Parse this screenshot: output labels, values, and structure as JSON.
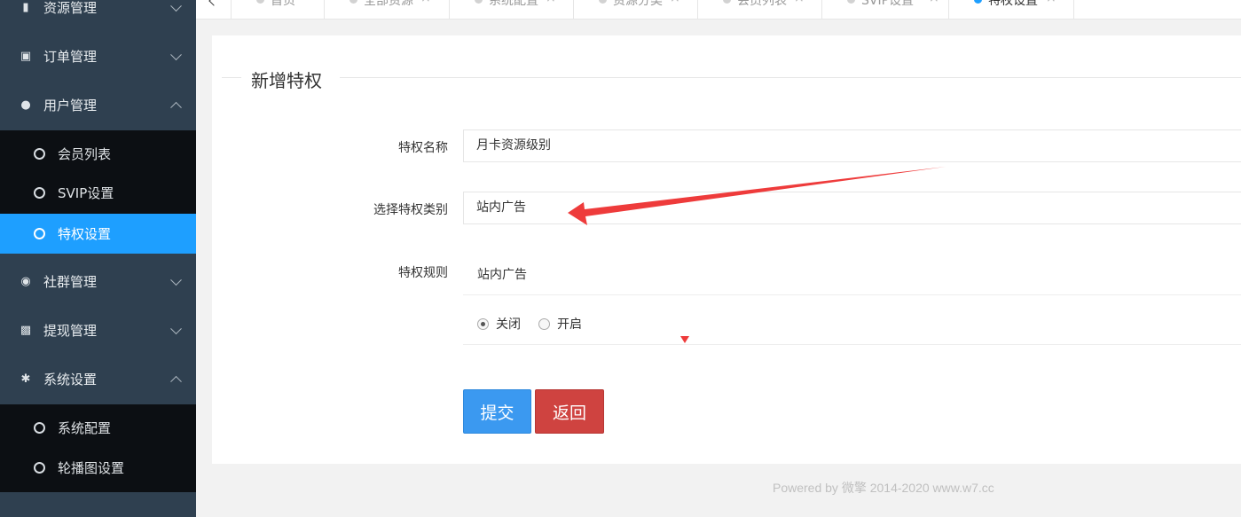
{
  "sidebar": {
    "menus": [
      {
        "label": "资源管理",
        "icon": "book-icon",
        "expanded": false
      },
      {
        "label": "订单管理",
        "icon": "cart-icon",
        "expanded": false
      },
      {
        "label": "用户管理",
        "icon": "users-icon",
        "expanded": true
      },
      {
        "label": "社群管理",
        "icon": "comments-icon",
        "expanded": false
      },
      {
        "label": "提现管理",
        "icon": "money-icon",
        "expanded": false
      },
      {
        "label": "系统设置",
        "icon": "gear-icon",
        "expanded": true
      }
    ],
    "user_sub": [
      {
        "label": "会员列表"
      },
      {
        "label": "SVIP设置"
      },
      {
        "label": "特权设置",
        "active": true
      }
    ],
    "system_sub": [
      {
        "label": "系统配置"
      },
      {
        "label": "轮播图设置"
      }
    ]
  },
  "tabs": [
    {
      "label": "首页"
    },
    {
      "label": "全部资源"
    },
    {
      "label": "系统配置"
    },
    {
      "label": "资源分类"
    },
    {
      "label": "会员列表"
    },
    {
      "label": "SVIP设置"
    },
    {
      "label": "特权设置",
      "active": true
    }
  ],
  "tab_close": "×",
  "form": {
    "legend": "新增特权",
    "name_label": "特权名称",
    "name_value": "月卡资源级别",
    "type_label": "选择特权类别",
    "type_value": "站内广告",
    "rule_label": "特权规则",
    "rule_title": "站内广告",
    "radio_off": "关闭",
    "radio_on": "开启",
    "selected": "关闭",
    "submit": "提交",
    "back": "返回"
  },
  "footer": "Powered by 微擎 2014-2020 www.w7.cc",
  "colors": {
    "sidebar_bg": "#2f4050",
    "sub_bg": "#0c0f13",
    "active_blue": "#1e9fff",
    "submit_blue": "#3b99f0",
    "back_red": "#cf4340",
    "annotation_red": "#ee3b3b"
  }
}
